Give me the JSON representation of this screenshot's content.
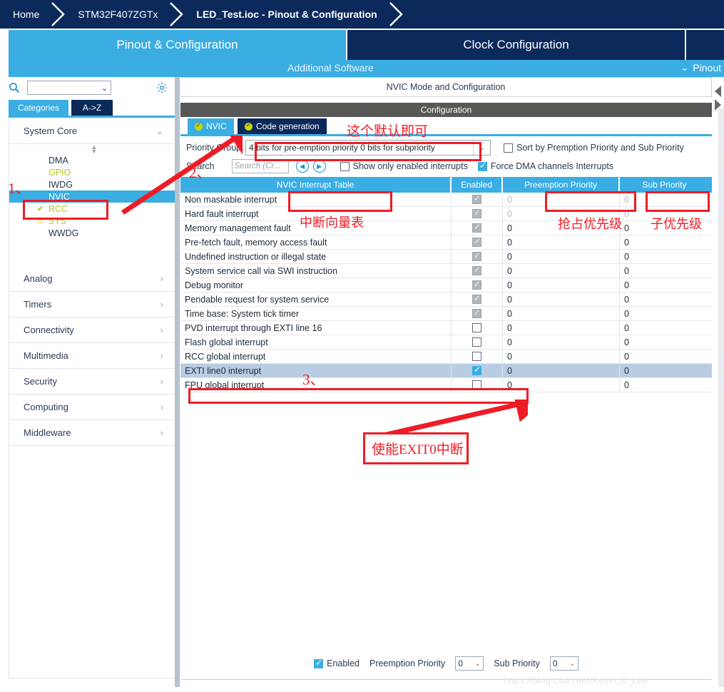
{
  "breadcrumb": {
    "items": [
      {
        "label": "Home",
        "active": false
      },
      {
        "label": "STM32F407ZGTx",
        "active": false
      },
      {
        "label": "LED_Test.ioc - Pinout & Configuration",
        "active": true
      }
    ]
  },
  "main_tabs": [
    {
      "label": "Pinout & Configuration",
      "selected": true
    },
    {
      "label": "Clock Configuration",
      "selected": false
    }
  ],
  "subbar": {
    "additional_software": "Additional Software",
    "pinout_label": "Pinout",
    "chevron": "⌄"
  },
  "sidebar": {
    "search_placeholder": "",
    "search_value": "",
    "combo_arrow": "⌄",
    "gear_icon": "gear-icon",
    "tabs": [
      {
        "label": "Categories",
        "selected": true
      },
      {
        "label": "A->Z",
        "selected": false
      }
    ],
    "group": {
      "label": "System Core",
      "expanded": true,
      "arrow": "⌄"
    },
    "peripherals": [
      {
        "label": "DMA",
        "state": "plain",
        "selected": false
      },
      {
        "label": "GPIO",
        "state": "configured",
        "selected": false
      },
      {
        "label": "IWDG",
        "state": "plain",
        "selected": false
      },
      {
        "label": "NVIC",
        "state": "plain",
        "selected": true
      },
      {
        "label": "RCC",
        "state": "ok",
        "selected": false
      },
      {
        "label": "SYS",
        "state": "warn",
        "selected": false
      },
      {
        "label": "WWDG",
        "state": "plain",
        "selected": false
      }
    ],
    "categories": [
      {
        "label": "Analog",
        "arrow": "›"
      },
      {
        "label": "Timers",
        "arrow": "›"
      },
      {
        "label": "Connectivity",
        "arrow": "›"
      },
      {
        "label": "Multimedia",
        "arrow": "›"
      },
      {
        "label": "Security",
        "arrow": "›"
      },
      {
        "label": "Computing",
        "arrow": "›"
      },
      {
        "label": "Middleware",
        "arrow": "›"
      }
    ]
  },
  "content": {
    "mode_header": "NVIC Mode and Configuration",
    "config_header": "Configuration",
    "tabs": [
      {
        "label": "NVIC",
        "selected": true
      },
      {
        "label": "Code generation",
        "selected": false
      }
    ],
    "priority_group": {
      "label": "Priority Group",
      "value": "4 bits for pre-emption priority 0 bits for subpriority",
      "arrow": "⌄"
    },
    "sort_checkbox": {
      "label": "Sort by Premption Priority and Sub Priority",
      "checked": false
    },
    "search": {
      "label": "Search",
      "placeholder": "Search (Cr...",
      "value": "",
      "prev_icon": "chevron-left-icon",
      "next_icon": "chevron-right-icon"
    },
    "show_only_enabled": {
      "label": "Show only enabled interrupts",
      "checked": false
    },
    "force_dma": {
      "label": "Force DMA channels Interrupts",
      "checked": true
    },
    "table": {
      "columns": [
        "NVIC Interrupt Table",
        "Enabled",
        "Preemption Priority",
        "Sub Priority"
      ],
      "rows": [
        {
          "name": "Non maskable interrupt",
          "enabled": true,
          "locked": true,
          "pre": "0",
          "sub": "0",
          "dim": true,
          "selected": false
        },
        {
          "name": "Hard fault interrupt",
          "enabled": true,
          "locked": true,
          "pre": "0",
          "sub": "0",
          "dim": true,
          "selected": false
        },
        {
          "name": "Memory management fault",
          "enabled": true,
          "locked": true,
          "pre": "0",
          "sub": "0",
          "dim": false,
          "selected": false
        },
        {
          "name": "Pre-fetch fault, memory access fault",
          "enabled": true,
          "locked": true,
          "pre": "0",
          "sub": "0",
          "dim": false,
          "selected": false
        },
        {
          "name": "Undefined instruction or illegal state",
          "enabled": true,
          "locked": true,
          "pre": "0",
          "sub": "0",
          "dim": false,
          "selected": false
        },
        {
          "name": "System service call via SWI instruction",
          "enabled": true,
          "locked": true,
          "pre": "0",
          "sub": "0",
          "dim": false,
          "selected": false
        },
        {
          "name": "Debug monitor",
          "enabled": true,
          "locked": true,
          "pre": "0",
          "sub": "0",
          "dim": false,
          "selected": false
        },
        {
          "name": "Pendable request for system service",
          "enabled": true,
          "locked": true,
          "pre": "0",
          "sub": "0",
          "dim": false,
          "selected": false
        },
        {
          "name": "Time base: System tick timer",
          "enabled": true,
          "locked": true,
          "pre": "0",
          "sub": "0",
          "dim": false,
          "selected": false
        },
        {
          "name": "PVD interrupt through EXTI line 16",
          "enabled": false,
          "locked": false,
          "pre": "0",
          "sub": "0",
          "dim": false,
          "selected": false
        },
        {
          "name": "Flash global interrupt",
          "enabled": false,
          "locked": false,
          "pre": "0",
          "sub": "0",
          "dim": false,
          "selected": false
        },
        {
          "name": "RCC global interrupt",
          "enabled": false,
          "locked": false,
          "pre": "0",
          "sub": "0",
          "dim": false,
          "selected": false
        },
        {
          "name": "EXTI line0 interrupt",
          "enabled": true,
          "locked": false,
          "pre": "0",
          "sub": "0",
          "dim": false,
          "selected": true
        },
        {
          "name": "FPU global interrupt",
          "enabled": false,
          "locked": false,
          "pre": "0",
          "sub": "0",
          "dim": false,
          "selected": false
        }
      ]
    },
    "bottom": {
      "enabled": {
        "label": "Enabled",
        "checked": true
      },
      "preemption": {
        "label": "Preemption Priority",
        "value": "0",
        "arrow": "⌄"
      },
      "sub": {
        "label": "Sub Priority",
        "value": "0",
        "arrow": "⌄"
      }
    }
  },
  "annotations": {
    "step1": "1、",
    "step2": "2、",
    "step3": "3、",
    "note_default": "这个默认即可",
    "note_vector_table": "中断向量表",
    "note_preemption": "抢占优先级",
    "note_sub": "子优先级",
    "note_enable_exti": "使能EXIT0中断",
    "color": "#ee1c25"
  },
  "watermark": "https://blog.csdn.net/Kevin_8_Lee"
}
